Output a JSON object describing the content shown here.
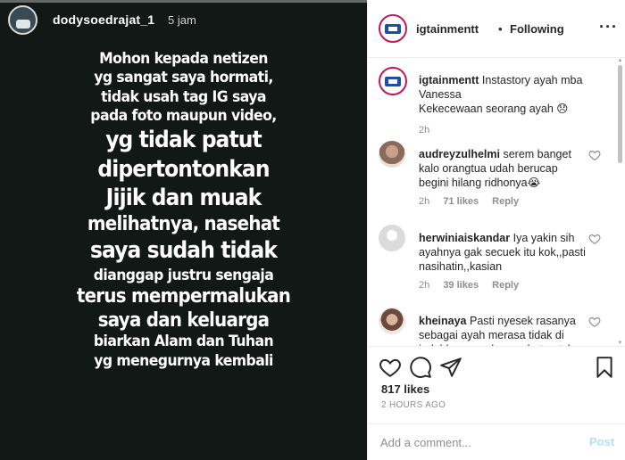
{
  "story": {
    "username": "dodysoedrajat_1",
    "time": "5 jam",
    "lines": [
      {
        "text": "Mohon kepada netizen",
        "size": "m"
      },
      {
        "text": "yg sangat saya hormati,",
        "size": "m"
      },
      {
        "text": "tidak usah tag IG saya",
        "size": "m"
      },
      {
        "text": "pada foto maupun video,",
        "size": "m"
      },
      {
        "text": "yg tidak patut",
        "size": "xl"
      },
      {
        "text": "dipertontonkan",
        "size": "xl"
      },
      {
        "text": "Jijik dan muak",
        "size": "xl"
      },
      {
        "text": "melihatnya, nasehat",
        "size": "l"
      },
      {
        "text": "saya sudah tidak",
        "size": "xl"
      },
      {
        "text": "dianggap justru sengaja",
        "size": "m"
      },
      {
        "text": "terus mempermalukan",
        "size": "l"
      },
      {
        "text": "saya dan keluarga",
        "size": "l"
      },
      {
        "text": "biarkan Alam dan Tuhan",
        "size": "m"
      },
      {
        "text": "yg menegurnya kembali",
        "size": "m"
      }
    ]
  },
  "post": {
    "header": {
      "username": "igtainmentt",
      "separator": "•",
      "follow_label": "Following",
      "more_icon": "more-options-icon"
    },
    "caption": {
      "username": "igtainmentt",
      "text": "Instastory ayah mba Vanessa",
      "line2": "Kekecewaan seorang ayah 😞",
      "time": "2h"
    },
    "comments": [
      {
        "username": "audreyzulhelmi",
        "text": "serem banget kalo orangtua udah berucap begini hilang ridhonya😭",
        "time": "2h",
        "likes": "71 likes",
        "reply": "Reply"
      },
      {
        "username": "herwiniaiskandar",
        "text": "Iya yakin sih ayahnya gak secuek itu kok,,pasti nasihatin,,kasian",
        "time": "2h",
        "likes": "39 likes",
        "reply": "Reply"
      },
      {
        "username": "kheinaya",
        "text": "Pasti nyesek rasanya sebagai ayah merasa tidak di indahkan segala nasehat untuk",
        "time": "",
        "likes": "",
        "reply": ""
      }
    ],
    "likes_count": "817 likes",
    "time_ago": "2 HOURS AGO",
    "comment_placeholder": "Add a comment...",
    "post_button": "Post",
    "colors": {
      "post_button": "#b2dffc",
      "avatar_ring": "#c2185b",
      "muted": "#8e8e8e"
    }
  }
}
